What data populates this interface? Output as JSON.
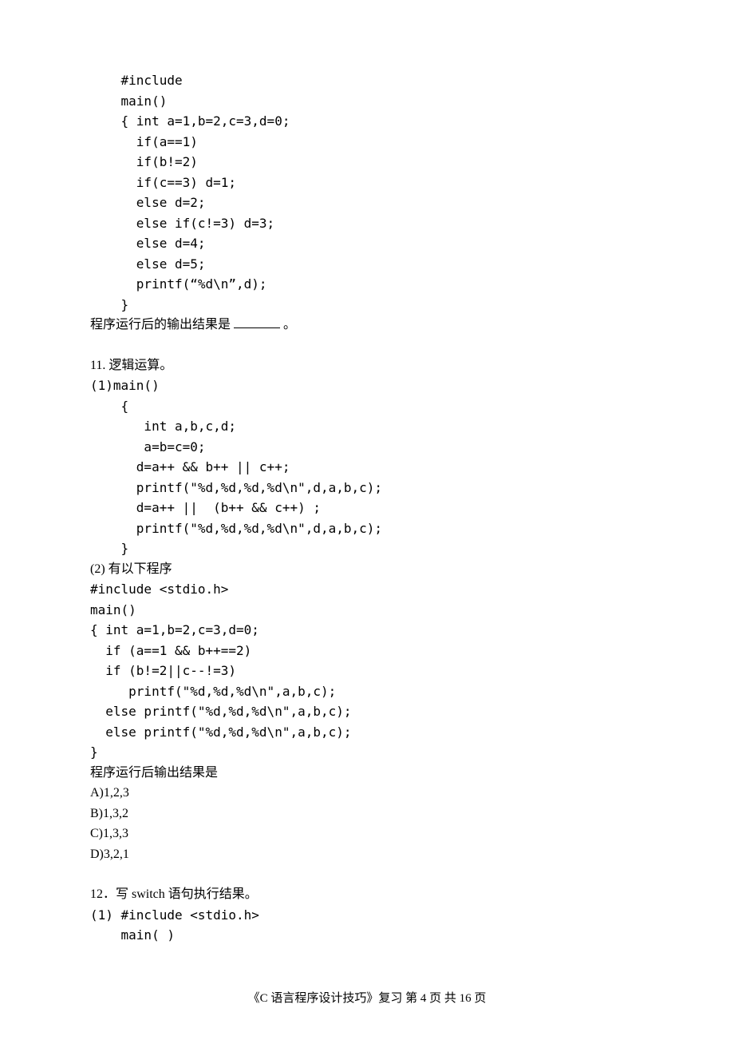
{
  "q10": {
    "code": [
      "    #include",
      "    main()",
      "    { int a=1,b=2,c=3,d=0;",
      "      if(a==1)",
      "      if(b!=2)",
      "      if(c==3) d=1;",
      "      else d=2;",
      "      else if(c!=3) d=3;",
      "      else d=4;",
      "      else d=5;",
      "      printf(“%d\\n”,d);",
      "    }"
    ],
    "result_prefix": "程序运行后的输出结果是 ",
    "result_suffix": " 。"
  },
  "q11": {
    "heading": "11. 逻辑运算。",
    "part1": [
      "(1)main()",
      "    {",
      "       int a,b,c,d;",
      "       a=b=c=0;",
      "      d=a++ && b++ || c++;",
      "      printf(\"%d,%d,%d,%d\\n\",d,a,b,c);",
      "",
      "      d=a++ ||  (b++ && c++) ;",
      "      printf(\"%d,%d,%d,%d\\n\",d,a,b,c);",
      "    }"
    ],
    "part2_heading": "(2) 有以下程序",
    "part2_code": [
      "#include <stdio.h>",
      "main()",
      "{ int a=1,b=2,c=3,d=0;",
      "  if (a==1 && b++==2)",
      "  if (b!=2||c--!=3)",
      "     printf(\"%d,%d,%d\\n\",a,b,c);",
      "  else printf(\"%d,%d,%d\\n\",a,b,c);",
      "  else printf(\"%d,%d,%d\\n\",a,b,c);",
      "}"
    ],
    "part2_result": "程序运行后输出结果是",
    "options": [
      "A)1,2,3",
      "B)1,3,2",
      "C)1,3,3",
      "D)3,2,1"
    ]
  },
  "q12": {
    "heading": "12．写 switch 语句执行结果。",
    "code": [
      "(1) #include <stdio.h>",
      "    main( )"
    ]
  },
  "footer": {
    "text": "《C 语言程序设计技巧》复习    第 4 页 共 16 页"
  }
}
